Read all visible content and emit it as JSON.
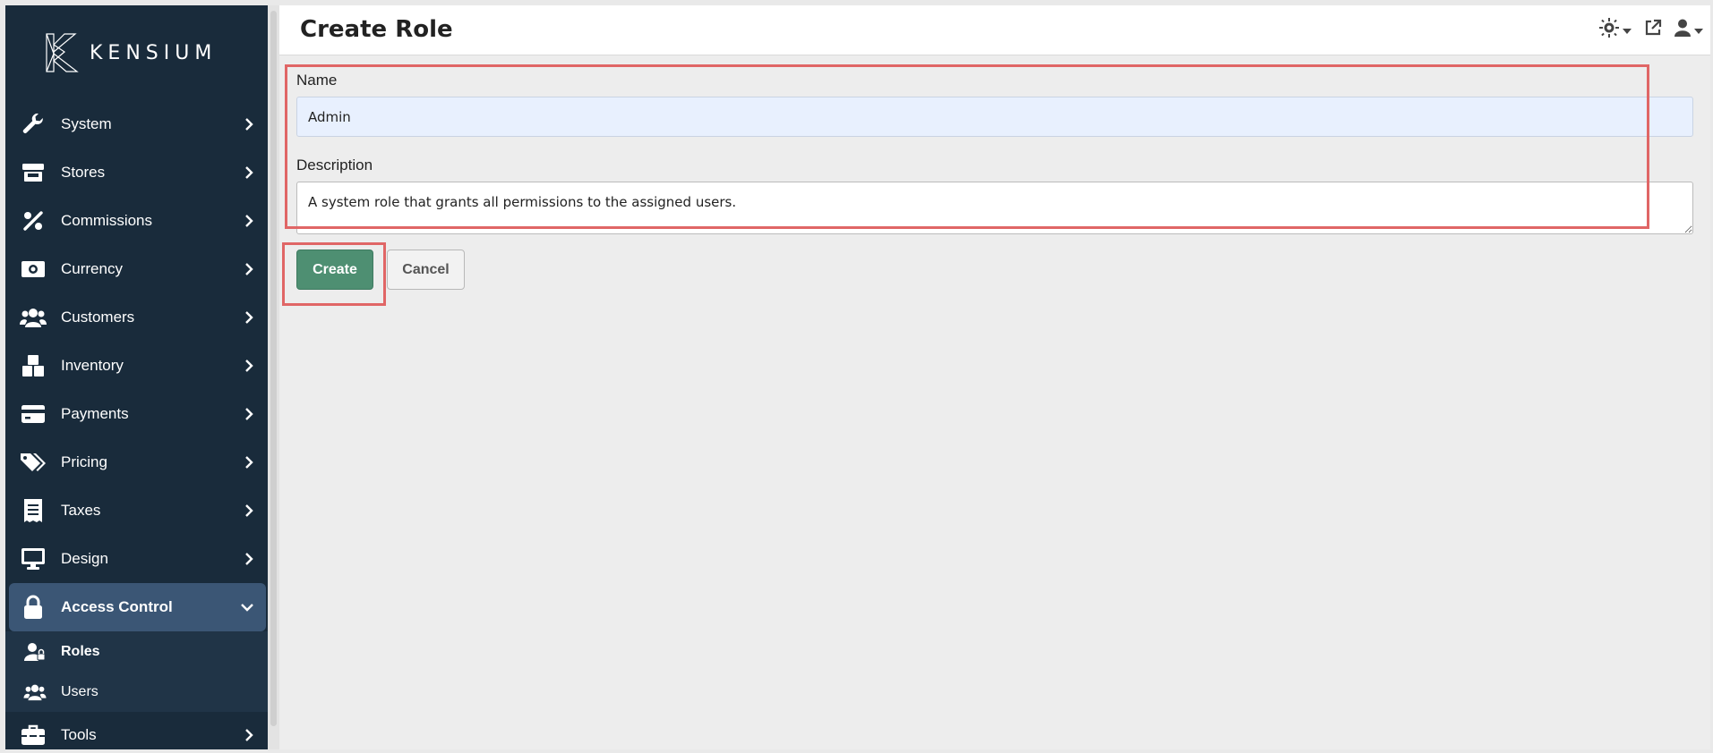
{
  "app": {
    "brand": "KENSIUM",
    "page_title": "Create Role"
  },
  "sidebar": {
    "items": [
      {
        "label": "System",
        "icon": "wrench-icon"
      },
      {
        "label": "Stores",
        "icon": "store-icon"
      },
      {
        "label": "Commissions",
        "icon": "percent-icon"
      },
      {
        "label": "Currency",
        "icon": "money-bill-icon"
      },
      {
        "label": "Customers",
        "icon": "users-icon"
      },
      {
        "label": "Inventory",
        "icon": "boxes-icon"
      },
      {
        "label": "Payments",
        "icon": "credit-card-icon"
      },
      {
        "label": "Pricing",
        "icon": "tags-icon"
      },
      {
        "label": "Taxes",
        "icon": "receipt-icon"
      },
      {
        "label": "Design",
        "icon": "desktop-icon"
      },
      {
        "label": "Access Control",
        "icon": "lock-icon"
      },
      {
        "label": "Tools",
        "icon": "toolbox-icon"
      }
    ],
    "access_control_sub": [
      {
        "label": "Roles",
        "icon": "user-lock-icon"
      },
      {
        "label": "Users",
        "icon": "users-icon"
      }
    ]
  },
  "header": {
    "icons": [
      "theme-sun-icon",
      "external-link-icon",
      "user-icon"
    ]
  },
  "form": {
    "name_label": "Name",
    "name_value": "Admin",
    "description_label": "Description",
    "description_value": "A system role that grants all permissions to the assigned users.",
    "create_label": "Create",
    "cancel_label": "Cancel"
  },
  "colors": {
    "sidebar_bg": "#192b3b",
    "active_item_bg": "#3b5675",
    "create_button": "#4e8f72",
    "highlight": "#e06666"
  }
}
